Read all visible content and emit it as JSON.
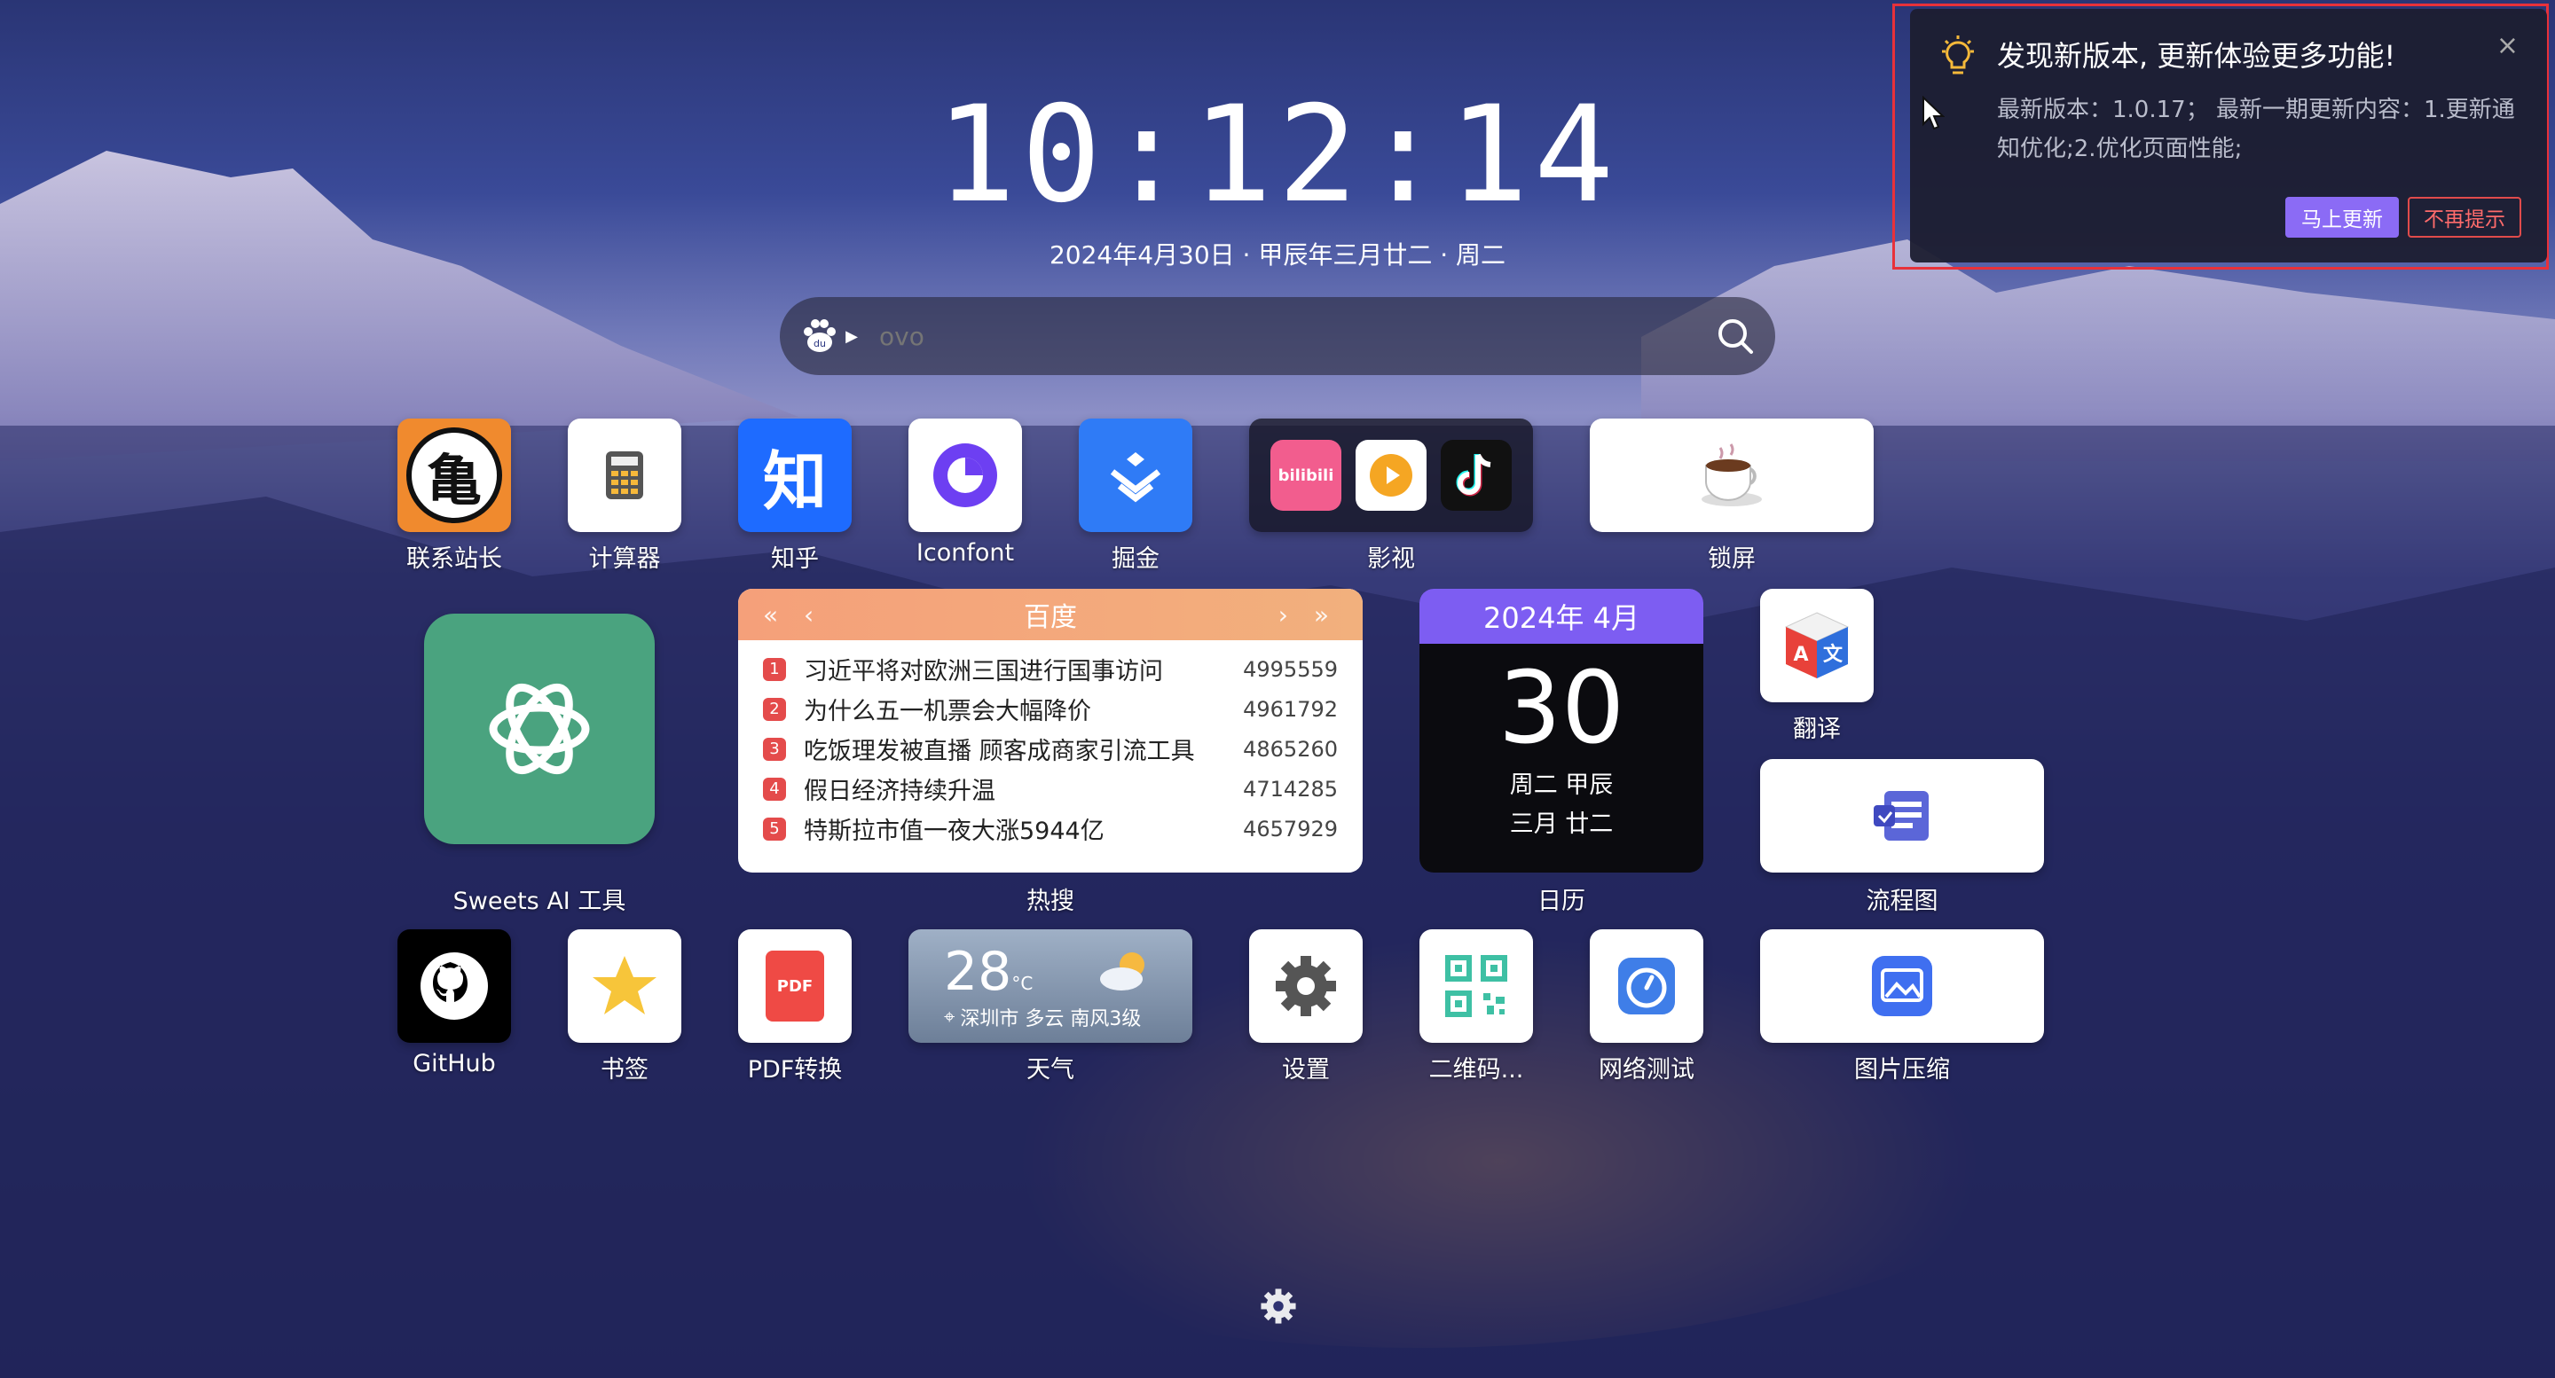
{
  "clock": {
    "time": "10:12:14",
    "date": "2024年4月30日 · 甲辰年三月廿二 · 周二"
  },
  "search": {
    "placeholder": "ovo",
    "engine_icon": "baidu-paw-icon"
  },
  "apps": {
    "contact": "联系站长",
    "calculator": "计算器",
    "zhihu": "知乎",
    "zhihu_glyph": "知",
    "iconfont": "Iconfont",
    "juejin": "掘金",
    "video": "影视",
    "lockscreen": "锁屏",
    "ai": "Sweets AI 工具",
    "hot_label": "热搜",
    "calendar_label": "日历",
    "translate": "翻译",
    "flowchart": "流程图",
    "github": "GitHub",
    "bookmark": "书签",
    "pdf": "PDF转换",
    "pdf_glyph": "PDF",
    "weather": "天气",
    "settings": "设置",
    "qrcode": "二维码...",
    "network": "网络测试",
    "imgcompress": "图片压缩",
    "bilibili_glyph": "bilibili"
  },
  "hot": {
    "title": "百度",
    "items": [
      {
        "rank": "1",
        "title": "习近平将对欧洲三国进行国事访问",
        "value": "4995559"
      },
      {
        "rank": "2",
        "title": "为什么五一机票会大幅降价",
        "value": "4961792"
      },
      {
        "rank": "3",
        "title": "吃饭理发被直播 顾客成商家引流工具",
        "value": "4865260"
      },
      {
        "rank": "4",
        "title": "假日经济持续升温",
        "value": "4714285"
      },
      {
        "rank": "5",
        "title": "特斯拉市值一夜大涨5944亿",
        "value": "4657929"
      }
    ]
  },
  "calendar": {
    "month": "2024年 4月",
    "day": "30",
    "line1": "周二 甲辰",
    "line2": "三月 廿二"
  },
  "weather": {
    "temp": "28",
    "unit": "°C",
    "location": "深圳市 多云 南风3级"
  },
  "notice": {
    "title": "发现新版本, 更新体验更多功能!",
    "body": "最新版本：1.0.17； 最新一期更新内容：1.更新通知优化;2.优化页面性能;",
    "update_label": "马上更新",
    "dismiss_label": "不再提示",
    "close": "×"
  },
  "colors": {
    "accent": "#8b6bf5",
    "hot_header": "#f5a07a",
    "chatgpt": "#4aa37f",
    "zhihu": "#1e6bff",
    "highlight_frame": "#e8313a"
  }
}
